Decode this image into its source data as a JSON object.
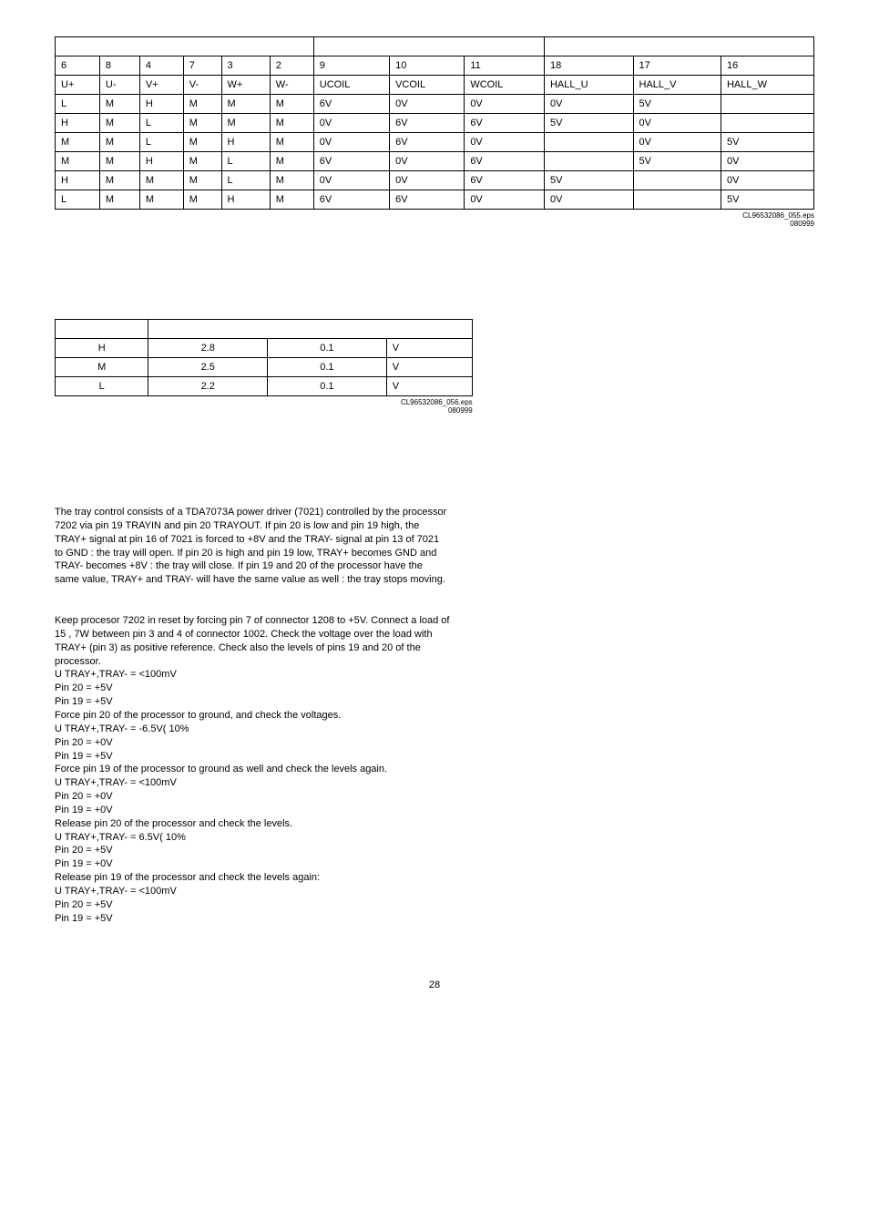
{
  "table1": {
    "headers": [
      "6",
      "8",
      "4",
      "7",
      "3",
      "2",
      "9",
      "10",
      "11",
      "18",
      "17",
      "16"
    ],
    "labels": [
      "U+",
      "U-",
      "V+",
      "V-",
      "W+",
      "W-",
      "UCOIL",
      "VCOIL",
      "WCOIL",
      "HALL_U",
      "HALL_V",
      "HALL_W"
    ],
    "rows": [
      [
        "L",
        "M",
        "H",
        "M",
        "M",
        "M",
        "6V",
        "0V",
        "0V",
        "0V",
        "5V",
        ""
      ],
      [
        "H",
        "M",
        "L",
        "M",
        "M",
        "M",
        "0V",
        "6V",
        "6V",
        "5V",
        "0V",
        ""
      ],
      [
        "M",
        "M",
        "L",
        "M",
        "H",
        "M",
        "0V",
        "6V",
        "0V",
        "",
        "0V",
        "5V"
      ],
      [
        "M",
        "M",
        "H",
        "M",
        "L",
        "M",
        "6V",
        "0V",
        "6V",
        "",
        "5V",
        "0V"
      ],
      [
        "H",
        "M",
        "M",
        "M",
        "L",
        "M",
        "0V",
        "0V",
        "6V",
        "5V",
        "",
        "0V"
      ],
      [
        "L",
        "M",
        "M",
        "M",
        "H",
        "M",
        "6V",
        "6V",
        "0V",
        "0V",
        "",
        "5V"
      ]
    ],
    "caption1": "CL96532086_055.eps",
    "caption2": "080999"
  },
  "table2": {
    "rows": [
      [
        "H",
        "2.8",
        "0.1",
        "V"
      ],
      [
        "M",
        "2.5",
        "0.1",
        "V"
      ],
      [
        "L",
        "2.2",
        "0.1",
        "V"
      ]
    ],
    "caption1": "CL96532086_056.eps",
    "caption2": "080999"
  },
  "para1": "The tray control consists of a TDA7073A power driver (7021) controlled by the processor 7202 via pin 19 TRAYIN and pin 20 TRAYOUT. If pin 20 is low and pin 19 high, the TRAY+ signal at pin 16 of 7021 is forced to +8V and the TRAY- signal at pin 13 of 7021 to GND : the tray will open. If pin 20 is high and pin 19 low, TRAY+ becomes GND and TRAY- becomes +8V : the tray will close. If pin 19 and 20 of the processor have the same value, TRAY+ and TRAY- will have the same value as well : the tray stops moving.",
  "para2_lines": [
    "Keep procesor 7202 in reset by forcing pin 7 of connector 1208 to +5V. Connect a load of 15  , 7W between pin 3 and 4 of connector 1002. Check the voltage over the load with TRAY+ (pin 3) as positive reference. Check also the levels of pins 19 and 20 of the processor.",
    "U TRAY+,TRAY- = <100mV",
    "Pin 20 = +5V",
    "Pin 19 = +5V",
    "Force pin 20 of the processor to ground, and check the voltages.",
    "U TRAY+,TRAY- = -6.5V( 10%",
    "Pin 20 = +0V",
    "Pin 19 = +5V",
    "Force pin 19 of the processor to ground as well and check the levels again.",
    "U TRAY+,TRAY- = <100mV",
    "Pin 20 = +0V",
    "Pin 19 = +0V",
    "Release pin 20 of the processor and check the levels.",
    "U TRAY+,TRAY- = 6.5V( 10%",
    "Pin 20 = +5V",
    "Pin 19 = +0V",
    "Release pin 19 of the processor and check the levels again:",
    "U TRAY+,TRAY- = <100mV",
    "Pin 20 = +5V",
    "Pin 19 = +5V"
  ],
  "pagenum": "28"
}
